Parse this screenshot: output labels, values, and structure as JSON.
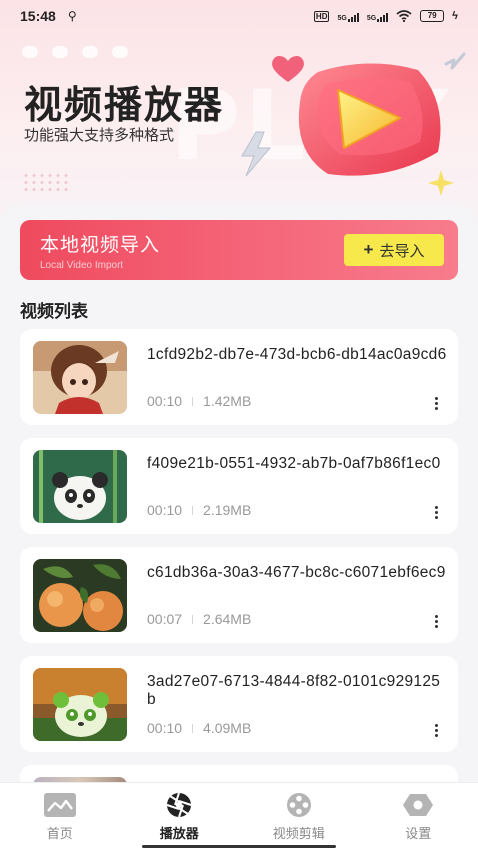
{
  "status_bar": {
    "time": "15:48",
    "usb_symbol": "⚲",
    "hd_label": "HD",
    "net1": "5G",
    "net2": "5G",
    "battery": "79"
  },
  "hero": {
    "title": "视频播放器",
    "subtitle": "功能强大支持多种格式",
    "watermark": "PLAY"
  },
  "import_banner": {
    "title": "本地视频导入",
    "subtitle": "Local Video Import",
    "button_label": "去导入"
  },
  "video_list": {
    "title": "视频列表",
    "items": [
      {
        "name": "1cfd92b2-db7e-473d-bcb6-db14ac0a9cd6",
        "duration": "00:10",
        "size": "1.42MB",
        "thumb": "girl-thumbnail"
      },
      {
        "name": "f409e21b-0551-4932-ab7b-0af7b86f1ec0",
        "duration": "00:10",
        "size": "2.19MB",
        "thumb": "panda-bamboo-thumbnail"
      },
      {
        "name": "c61db36a-30a3-4677-bc8c-c6071ebf6ec9",
        "duration": "00:07",
        "size": "2.64MB",
        "thumb": "peaches-thumbnail"
      },
      {
        "name": "3ad27e07-6713-4844-8f82-0101c929125b",
        "duration": "00:10",
        "size": "4.09MB",
        "thumb": "panda-green-thumbnail"
      }
    ]
  },
  "tabs": [
    {
      "label": "首页",
      "icon": "home-chart-icon",
      "active": false
    },
    {
      "label": "播放器",
      "icon": "aperture-icon",
      "active": true
    },
    {
      "label": "视频剪辑",
      "icon": "film-reel-icon",
      "active": false
    },
    {
      "label": "设置",
      "icon": "settings-hex-icon",
      "active": false
    }
  ],
  "colors": {
    "banner_start": "#ef4a5e",
    "banner_end": "#f77c8c",
    "import_button": "#f7e84b",
    "hero_bg": "#fbe3e6"
  }
}
